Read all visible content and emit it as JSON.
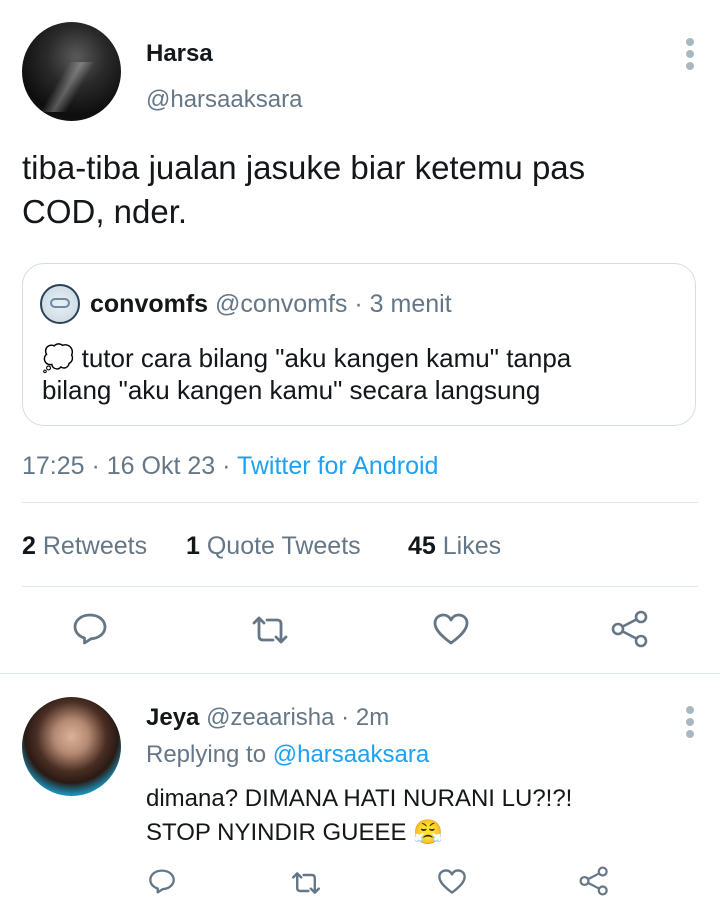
{
  "main_tweet": {
    "display_name": "Harsa",
    "handle": "@harsaaksara",
    "text_line1": "tiba-tiba jualan jasuke biar ketemu pas",
    "text_line2": "COD, nder.",
    "quoted": {
      "display_name": "convomfs",
      "handle": "@convomfs",
      "separator": "·",
      "time": "3 menit",
      "thought_emoji": "💭",
      "text_line1": "tutor cara bilang \"aku kangen kamu\" tanpa",
      "text_line2": "bilang \"aku kangen kamu\" secara langsung"
    },
    "timestamp": "17:25 · 16 Okt 23 ·",
    "source": "Twitter for Android",
    "stats": {
      "retweets_count": "2",
      "retweets_label": "Retweets",
      "quotes_count": "1",
      "quotes_label": "Quote Tweets",
      "likes_count": "45",
      "likes_label": "Likes"
    }
  },
  "reply": {
    "display_name": "Jeya",
    "handle": "@zeaarisha",
    "separator": "·",
    "time": "2m",
    "replying_prefix": "Replying to",
    "replying_handle": "@harsaaksara",
    "text_line1": "dimana? DIMANA HATI NURANI LU?!?!",
    "text_line2": "STOP NYINDIR GUEEE",
    "emoji": "😤"
  },
  "icons": {
    "reply": "reply-icon",
    "retweet": "retweet-icon",
    "like": "heart-icon",
    "share": "share-icon",
    "more": "more-vertical-icon"
  },
  "colors": {
    "link": "#1da1f2",
    "secondary_text": "#657786",
    "icon_gray": "#657786",
    "divider": "#e1e8ed"
  }
}
